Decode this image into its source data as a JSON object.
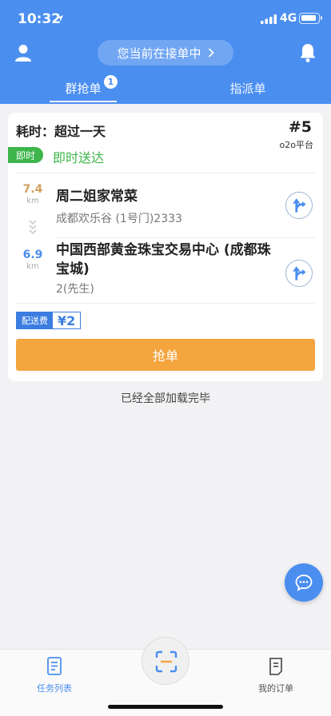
{
  "status_bar": {
    "time": "10:32",
    "network": "4G"
  },
  "header": {
    "status_pill": "您当前在接单中"
  },
  "tabs": [
    {
      "label": "群抢单",
      "badge": "1",
      "active": true
    },
    {
      "label": "指派单",
      "active": false
    }
  ],
  "order": {
    "elapsed": "耗时：超过一天",
    "number": "#5",
    "platform": "o2o平台",
    "instant_tag": "即时",
    "delivery_type": "即时送达",
    "pickup": {
      "distance": "7.4",
      "unit": "km",
      "name": "周二姐家常菜",
      "address": "成都欢乐谷 (1号门)2333"
    },
    "dropoff": {
      "distance": "6.9",
      "unit": "km",
      "name": "中国西部黄金珠宝交易中心 (成都珠宝城)",
      "address": "2(先生)"
    },
    "fee_label": "配送费",
    "fee_value": "¥2",
    "grab_label": "抢单"
  },
  "list_footer": "已经全部加载完毕",
  "bottom_nav": {
    "tasks_label": "任务列表",
    "orders_label": "我的订单"
  },
  "colors": {
    "primary": "#4a8ef0",
    "accent_orange": "#f4a53e",
    "green": "#3db54a"
  }
}
